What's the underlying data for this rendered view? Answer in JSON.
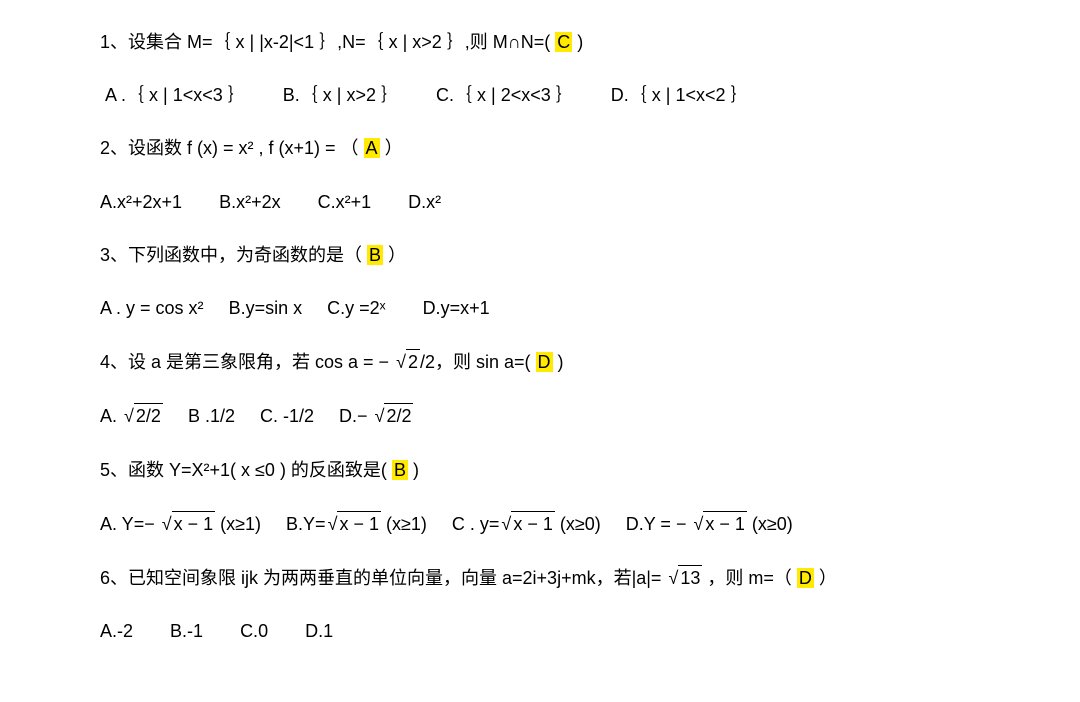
{
  "q1": {
    "stem_a": "1、设集合 M=｛ x | |x-2|<1 ｝,N=｛ x | x>2 ｝,则 M∩N=( ",
    "hl": "C",
    "stem_b": " )",
    "opts": {
      "A": "A .｛ x | 1<x<3 ｝",
      "B": "B.｛ x | x>2 ｝",
      "C": "C.｛ x | 2<x<3 ｝",
      "D": "D.｛ x | 1<x<2 ｝"
    }
  },
  "q2": {
    "stem_a": "2、设函数  f (x) = x² ,   f (x+1) = （  ",
    "hl": "A",
    "stem_b": "  ）",
    "opts": {
      "A": "A.x²+2x+1",
      "B": "B.x²+2x",
      "C": "C.x²+1",
      "D": "D.x²"
    }
  },
  "q3": {
    "stem_a": "3、下列函数中，为奇函数的是（  ",
    "hl": "B",
    "stem_b": "  ）",
    "opts": {
      "A": "A . y = cos x²",
      "B": "B.y=sin x",
      "C": "C.y =2ˣ",
      "D": "D.y=x+1"
    }
  },
  "q4": {
    "stem_a": "4、设 a 是第三象限角，若 cos a = − ",
    "sqrt1_arg": "2",
    "stem_b": "/2，则 sin a=(   ",
    "hl": "D",
    "stem_c": "   )",
    "opts": {
      "A_pre": "A. ",
      "A_arg": "2/2",
      "B": "B .1/2",
      "C": "C. -1/2",
      "D_pre": "D.− ",
      "D_arg": "2/2"
    }
  },
  "q5": {
    "stem_a": "5、函数 Y=X²+1( x ≤0 ) 的反函致是(   ",
    "hl": "B",
    "stem_b": "   )",
    "opts": {
      "A_pre": "A. Y=− ",
      "A_arg": "x − 1",
      "A_post": " (x≥1)",
      "B_pre": "B.Y=",
      "B_arg": "x − 1",
      "B_post": " (x≥1)",
      "C_pre": "C . y=",
      "C_arg": "x − 1",
      "C_post": " (x≥0)",
      "D_pre": "D.Y = − ",
      "D_arg": "x − 1",
      "D_post": " (x≥0)"
    }
  },
  "q6": {
    "stem_a": "6、已知空间象限 ijk 为两两垂直的单位向量，向量 a=2i+3j+mk，若|a|= ",
    "sqrt_arg": "13",
    "stem_b": " ，则 m=（  ",
    "hl": "D",
    "stem_c": "  ）",
    "opts": {
      "A": "A.-2",
      "B": "B.-1",
      "C": "C.0",
      "D": "D.1"
    }
  }
}
